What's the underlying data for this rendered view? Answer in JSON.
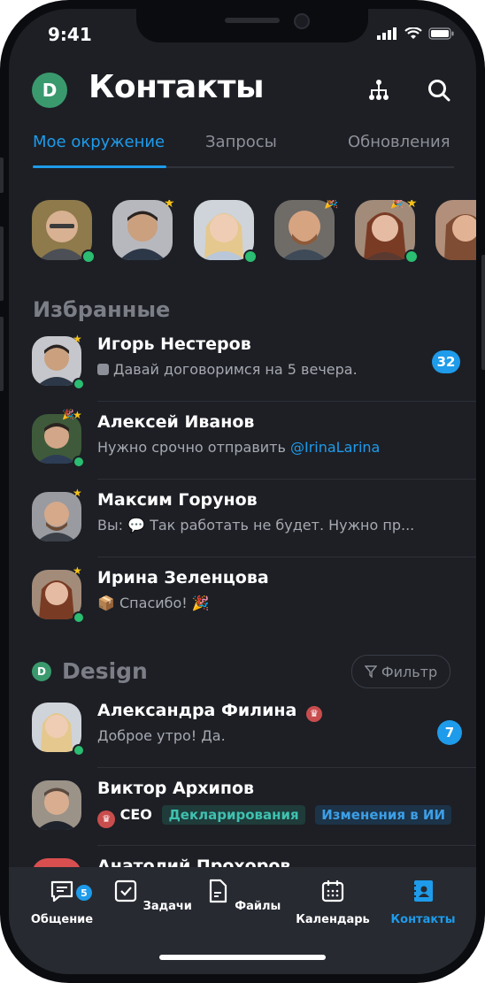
{
  "status": {
    "time": "9:41"
  },
  "header": {
    "avatar_letter": "D",
    "title": "Контакты"
  },
  "tabs": [
    "Мое окружение",
    "Запросы",
    "Обновления"
  ],
  "favorites": {
    "title": "Избранные",
    "items": [
      {
        "name": "Игорь Нестеров",
        "msg": "Давай договоримся на 5 вечера.",
        "badge": "32"
      },
      {
        "name": "Алексей Иванов",
        "msg_prefix": "Нужно срочно отправить ",
        "mention": "@IrinaLarina"
      },
      {
        "name": "Максим Горунов",
        "msg": "Вы: 💬 Так работать не будет. Нужно пр..."
      },
      {
        "name": "Ирина Зеленцова",
        "msg": "📦 Спасибо! 🎉"
      }
    ]
  },
  "design": {
    "avatar_letter": "D",
    "title": "Design",
    "filter_label": "Фильтр",
    "items": [
      {
        "name": "Александра Филина",
        "msg": "Доброе утро! Да.",
        "badge": "7"
      },
      {
        "name": "Виктор Архипов",
        "role": "CEO",
        "chips": [
          "Декларирования",
          "Изменения в ИИ"
        ]
      },
      {
        "name": "Анатолий Прохоров"
      }
    ]
  },
  "bottom_nav": [
    {
      "label": "Общение",
      "badge": "5"
    },
    {
      "label": "Задачи"
    },
    {
      "label": "Файлы"
    },
    {
      "label": "Календарь"
    },
    {
      "label": "Контакты"
    }
  ],
  "colors": {
    "accent": "#1e9bea",
    "online": "#2bbd71",
    "star": "#f6c21a",
    "bg": "#1d1f25"
  }
}
